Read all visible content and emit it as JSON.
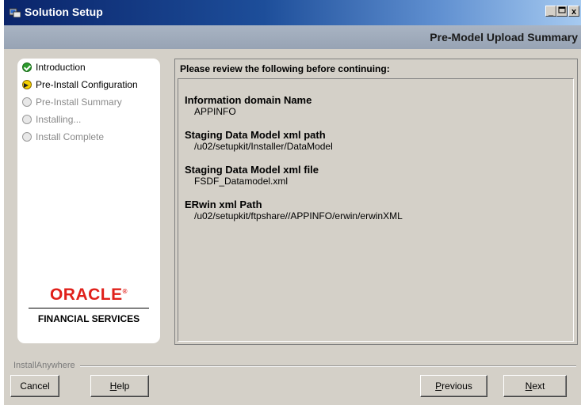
{
  "window": {
    "title": "Solution Setup",
    "minimize": "_",
    "close": "x"
  },
  "header": {
    "title": "Pre-Model Upload Summary"
  },
  "steps": [
    {
      "label": "Introduction",
      "state": "done"
    },
    {
      "label": "Pre-Install Configuration",
      "state": "current"
    },
    {
      "label": "Pre-Install Summary",
      "state": "pending"
    },
    {
      "label": "Installing...",
      "state": "pending"
    },
    {
      "label": "Install Complete",
      "state": "pending"
    }
  ],
  "logo": {
    "brand": "ORACLE",
    "brand_mark": "®",
    "subtitle": "FINANCIAL SERVICES"
  },
  "content": {
    "heading": "Please review the following before continuing:",
    "fields": [
      {
        "label": "Information domain Name",
        "value": "APPINFO"
      },
      {
        "label": "Staging Data Model xml path",
        "value": "/u02/setupkit/Installer/DataModel"
      },
      {
        "label": "Staging Data Model xml file",
        "value": "FSDF_Datamodel.xml"
      },
      {
        "label": "ERwin xml Path",
        "value": "/u02/setupkit/ftpshare//APPINFO/erwin/erwinXML"
      }
    ]
  },
  "footer": {
    "brand": "InstallAnywhere",
    "cancel": "Cancel",
    "help_first": "H",
    "help_rest": "elp",
    "previous_first": "P",
    "previous_rest": "revious",
    "next_first": "N",
    "next_rest": "ext"
  },
  "colors": {
    "oracle_red": "#e0201a",
    "titlebar": "#0a246a",
    "header": "#a3aebe"
  }
}
